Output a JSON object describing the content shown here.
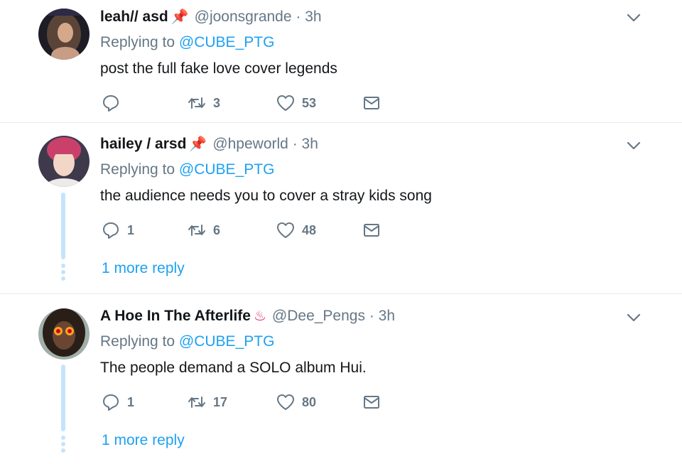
{
  "tweets": [
    {
      "name": "leah// asd",
      "emoji": "📌",
      "handle": "@joonsgrande",
      "time": "3h",
      "replying_prefix": "Replying to",
      "replying_to": "@CUBE_PTG",
      "text": "post the full fake love cover legends",
      "reply_count": "",
      "retweet_count": "3",
      "like_count": "53"
    },
    {
      "name": "hailey / arsd",
      "emoji": "📌",
      "handle": "@hpeworld",
      "time": "3h",
      "replying_prefix": "Replying to",
      "replying_to": "@CUBE_PTG",
      "text": "the audience needs you to cover a stray kids song",
      "reply_count": "1",
      "retweet_count": "6",
      "like_count": "48",
      "more_reply": "1 more reply"
    },
    {
      "name": "A Hoe In The Afterlife",
      "emoji": "♨",
      "handle": "@Dee_Pengs",
      "time": "3h",
      "replying_prefix": "Replying to",
      "replying_to": "@CUBE_PTG",
      "text": "The people demand a SOLO album Hui.",
      "reply_count": "1",
      "retweet_count": "17",
      "like_count": "80",
      "more_reply": "1 more reply"
    }
  ],
  "separator": "·",
  "colors": {
    "link": "#1da1f2",
    "muted": "#657786",
    "thread": "#c4e4fb",
    "divider": "#e6ecf0"
  },
  "icons": [
    "reply-icon",
    "retweet-icon",
    "like-icon",
    "dm-icon",
    "chevron-down-icon",
    "pin-icon",
    "hot-springs-icon"
  ]
}
